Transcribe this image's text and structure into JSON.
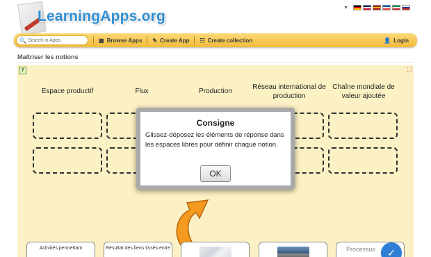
{
  "header": {
    "logo_text": "LearningApps.org",
    "lang_caret": "▼",
    "flags": [
      {
        "name": "flag-de",
        "colors": [
          "#000000",
          "#dd0000",
          "#ffce00"
        ]
      },
      {
        "name": "flag-gb",
        "colors": [
          "#012169",
          "#ffffff",
          "#c8102e"
        ]
      },
      {
        "name": "flag-es",
        "colors": [
          "#aa151b",
          "#f1bf00",
          "#aa151b"
        ]
      },
      {
        "name": "flag-fr",
        "colors": [
          "#0055a4",
          "#ffffff",
          "#ef4135"
        ]
      },
      {
        "name": "flag-it",
        "colors": [
          "#009246",
          "#ffffff",
          "#ce2b37"
        ]
      },
      {
        "name": "flag-ru",
        "colors": [
          "#ffffff",
          "#0039a6",
          "#d52b1e"
        ]
      }
    ]
  },
  "nav": {
    "search_placeholder": "Search in Apps",
    "search_icon": "🔍",
    "browse_label": "Browse Apps",
    "browse_icon": "▦",
    "create_app_label": "Create App",
    "create_app_icon": "✎",
    "create_collection_label": "Create collection",
    "create_collection_icon": "☷",
    "login_label": "Login",
    "login_icon": "👤"
  },
  "page": {
    "title": "Maîtriser les notions"
  },
  "app": {
    "help_icon": "?",
    "fullscreen_icon": "⛶",
    "columns": [
      "Espace productif",
      "Flux",
      "Production",
      "Réseau international de production",
      "Chaîne mondiale de valeur ajoutée"
    ],
    "cards": [
      "Activités permettant",
      "Résultat des liens tissés entre",
      "",
      "",
      "Processus"
    ],
    "check_icon": "✓"
  },
  "modal": {
    "title": "Consigne",
    "text": "Glissez-déposez les éléments de réponse dans les espaces libres pour définir chaque notion.",
    "ok_label": "OK"
  },
  "colors": {
    "accent": "#2f8ed4",
    "navbar": "#f2bb3a",
    "app_background": "#fbf1c4",
    "arrow": "#f39a1f"
  }
}
